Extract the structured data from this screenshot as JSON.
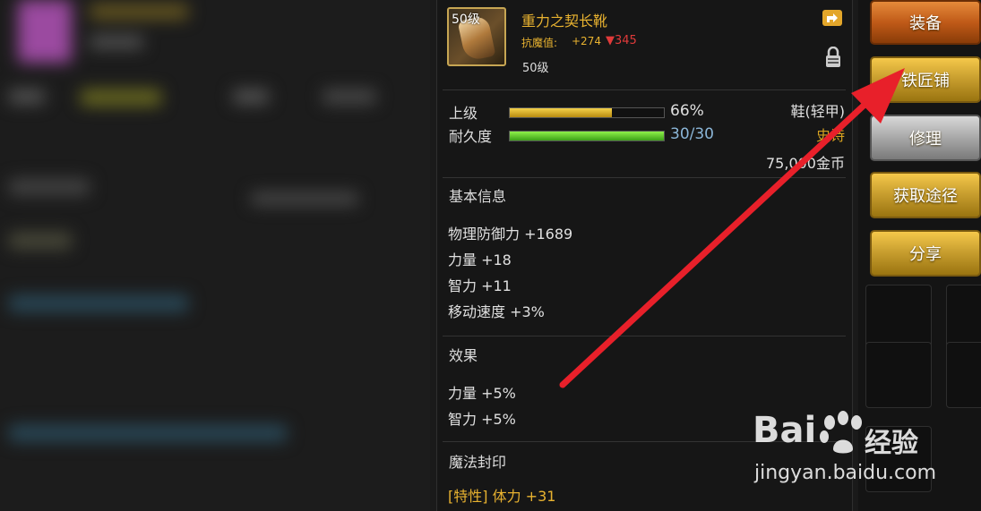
{
  "item": {
    "level_badge": "50级",
    "name": "重力之契长靴",
    "resist_label": "抗魔值:",
    "resist_up": "+274",
    "resist_down": "▼345",
    "level": "50级",
    "icon": "boots-icon"
  },
  "bars": {
    "upgrade": {
      "label": "上级",
      "value": "66%",
      "fraction": 0.66
    },
    "durability": {
      "label": "耐久度",
      "value": "30/30",
      "fraction": 1.0
    }
  },
  "meta": {
    "type": "鞋(轻甲)",
    "rarity": "史诗",
    "price": "75,000金币"
  },
  "sections": {
    "basic_title": "基本信息",
    "basic_stats": [
      "物理防御力 +1689",
      "力量 +18",
      "智力 +11",
      "移动速度 +3%"
    ],
    "effect_title": "效果",
    "effect_stats": [
      "力量 +5%",
      "智力 +5%"
    ],
    "seal_title": "魔法封印",
    "seal_stats": [
      "[特性] 体力 +31"
    ]
  },
  "buttons": {
    "equip": "装备",
    "blacksmith": "铁匠铺",
    "repair": "修理",
    "acquire": "获取途径",
    "share": "分享"
  },
  "watermark": {
    "logo": "Bai",
    "logo_suffix": "经验",
    "url": "jingyan.baidu.com"
  },
  "colors": {
    "item_name": "#e8b230",
    "price_down": "#e03a3a",
    "button_gold": "#caa030",
    "button_orange": "#c05a18",
    "arrow": "#e8202a"
  }
}
